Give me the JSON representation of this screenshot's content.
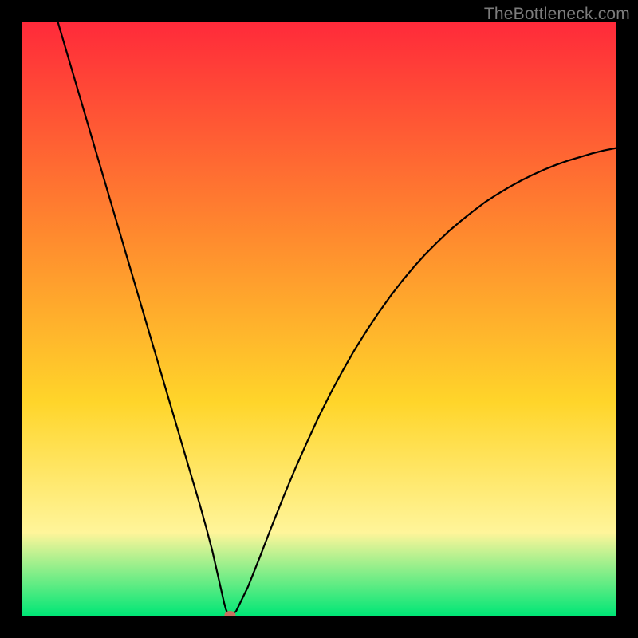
{
  "watermark": {
    "text": "TheBottleneck.com"
  },
  "colors": {
    "top": "#ff2a3a",
    "mid1": "#ff8a2e",
    "mid2": "#ffd52a",
    "mid3": "#fff59a",
    "bottom": "#00e676",
    "curve": "#000000",
    "marker": "#c97060"
  },
  "chart_data": {
    "type": "line",
    "title": "",
    "xlabel": "",
    "ylabel": "",
    "xlim": [
      0,
      100
    ],
    "ylim": [
      0,
      100
    ],
    "grid": false,
    "legend": false,
    "series": [
      {
        "name": "curve",
        "x": [
          6,
          8,
          10,
          12,
          14,
          16,
          18,
          20,
          22,
          24,
          26,
          28,
          30,
          31,
          32,
          32.5,
          33,
          33.5,
          34,
          34.3,
          34.6,
          35,
          36,
          38,
          40,
          42,
          44,
          46,
          48,
          50,
          52,
          54,
          56,
          58,
          60,
          62,
          64,
          66,
          68,
          70,
          72,
          74,
          76,
          78,
          80,
          82,
          84,
          86,
          88,
          90,
          92,
          94,
          96,
          98,
          100
        ],
        "y": [
          100,
          93.2,
          86.4,
          79.6,
          72.8,
          66,
          59.2,
          52.4,
          45.6,
          38.8,
          32,
          25.2,
          18.4,
          14.8,
          11,
          8.8,
          6.6,
          4.4,
          2.2,
          1.1,
          0.4,
          0.1,
          0.7,
          4.8,
          9.8,
          15,
          20,
          24.8,
          29.3,
          33.6,
          37.6,
          41.3,
          44.8,
          48,
          51,
          53.8,
          56.4,
          58.8,
          61,
          63,
          64.9,
          66.6,
          68.2,
          69.7,
          71,
          72.2,
          73.3,
          74.3,
          75.2,
          76,
          76.7,
          77.3,
          77.9,
          78.4,
          78.8
        ]
      }
    ],
    "marker": {
      "x": 35,
      "y": 0.1
    }
  }
}
